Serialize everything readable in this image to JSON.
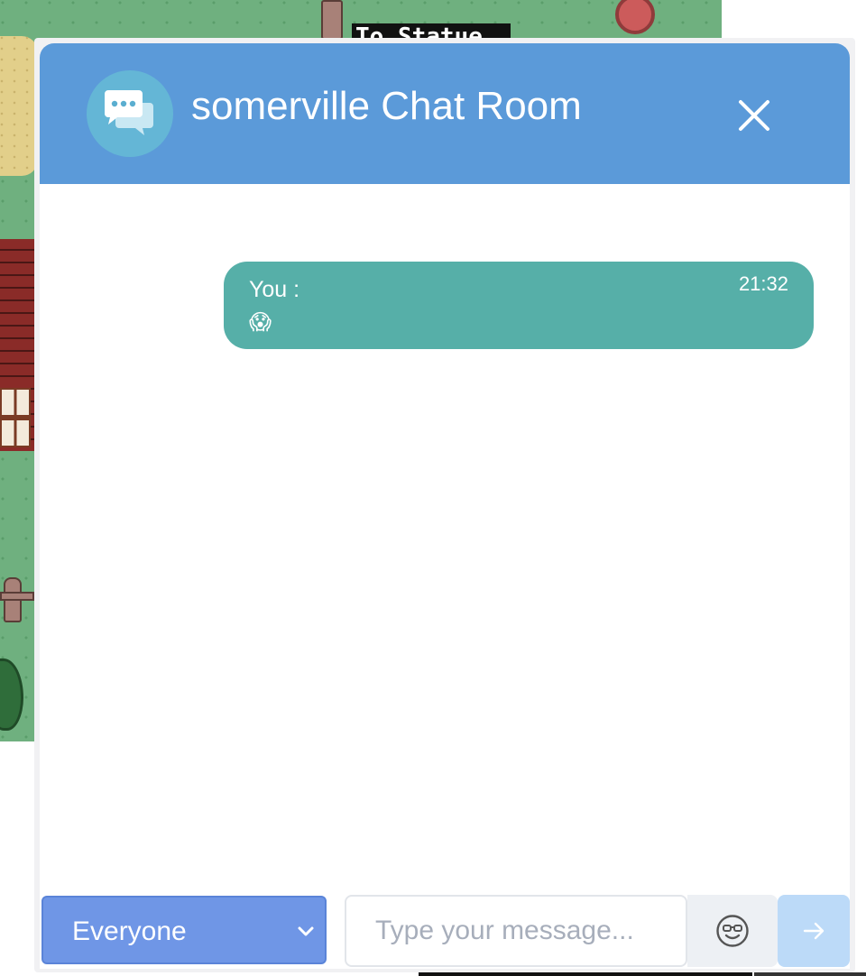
{
  "background": {
    "sign_text": "To Statue"
  },
  "chat": {
    "title": "somerville Chat Room",
    "header_icon": "chat-bubbles-icon",
    "close_icon": "close-icon",
    "accent_color": "#5b9ad9",
    "messages": [
      {
        "sender": "You :",
        "time": "21:32",
        "text": "😱",
        "bubble_color": "#56afa8"
      }
    ],
    "input": {
      "recipient": "Everyone",
      "placeholder": "Type your message...",
      "value": "",
      "emoji_icon": "emoji-smile-icon",
      "send_icon": "arrow-right-icon"
    }
  }
}
